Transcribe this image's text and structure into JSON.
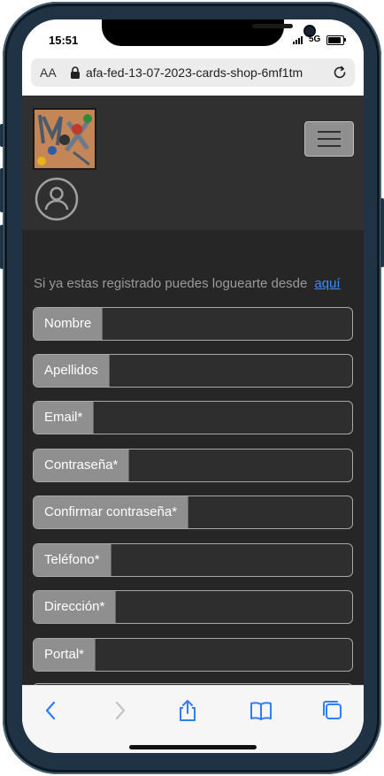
{
  "status_bar": {
    "time": "15:51",
    "network": "5G"
  },
  "browser": {
    "text_size_label": "AA",
    "url": "afa-fed-13-07-2023-cards-shop-6mf1tm",
    "icons": [
      "lock-icon",
      "reload-icon"
    ]
  },
  "navbar": {
    "logo_icon": "cards-shop-logo",
    "menu_icon": "hamburger-icon",
    "user_icon": "user-circle-icon"
  },
  "login_prompt": {
    "text": "Si ya estas registrado puedes loguearte desde",
    "link": "aquí"
  },
  "form": {
    "fields": [
      {
        "label": "Nombre",
        "value": ""
      },
      {
        "label": "Apellidos",
        "value": ""
      },
      {
        "label": "Email*",
        "value": ""
      },
      {
        "label": "Contraseña*",
        "value": ""
      },
      {
        "label": "Confirmar contraseña*",
        "value": ""
      },
      {
        "label": "Teléfono*",
        "value": ""
      },
      {
        "label": "Dirección*",
        "value": ""
      },
      {
        "label": "Portal*",
        "value": ""
      }
    ]
  },
  "toolbar": {
    "icons": [
      "back-icon",
      "forward-icon",
      "share-icon",
      "bookmarks-icon",
      "tabs-icon"
    ]
  },
  "colors": {
    "page_bg": "#262626",
    "navbar_bg": "#303030",
    "label_bg": "#8f8f8f",
    "link": "#3d8bfd",
    "frame": "#1f3344"
  }
}
